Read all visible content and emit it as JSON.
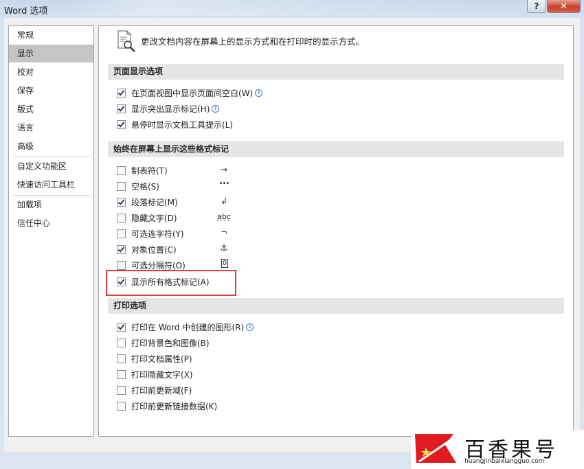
{
  "window": {
    "title": "Word 选项",
    "help_label": "?",
    "close_label": "✕"
  },
  "sidebar": {
    "items": [
      {
        "label": "常规"
      },
      {
        "label": "显示"
      },
      {
        "label": "校对"
      },
      {
        "label": "保存"
      },
      {
        "label": "版式"
      },
      {
        "label": "语言"
      },
      {
        "label": "高级"
      },
      {
        "label": "自定义功能区"
      },
      {
        "label": "快速访问工具栏"
      },
      {
        "label": "加载项"
      },
      {
        "label": "信任中心"
      }
    ],
    "selected": "显示"
  },
  "content": {
    "intro": "更改文档内容在屏幕上的显示方式和在打印时的显示方式。",
    "page_display": {
      "heading": "页面显示选项",
      "options": [
        {
          "label": "在页面视图中显示页面间空白(W)",
          "checked": true,
          "info": true
        },
        {
          "label": "显示突出显示标记(H)",
          "checked": true,
          "info": true
        },
        {
          "label": "悬停时显示文档工具提示(L)",
          "checked": true,
          "info": false
        }
      ]
    },
    "format_marks": {
      "heading": "始终在屏幕上显示这些格式标记",
      "options": [
        {
          "label": "制表符(T)",
          "checked": false,
          "symbol": "→"
        },
        {
          "label": "空格(S)",
          "checked": false,
          "symbol": "•••"
        },
        {
          "label": "段落标记(M)",
          "checked": true,
          "symbol": "↲"
        },
        {
          "label": "隐藏文字(D)",
          "checked": false,
          "symbol": "abc"
        },
        {
          "label": "可选连字符(Y)",
          "checked": false,
          "symbol": "¬"
        },
        {
          "label": "对象位置(C)",
          "checked": true,
          "symbol": "⚓"
        },
        {
          "label": "可选分隔符(O)",
          "checked": false,
          "symbol": "0"
        },
        {
          "label": "显示所有格式标记(A)",
          "checked": true,
          "symbol": ""
        }
      ]
    },
    "print": {
      "heading": "打印选项",
      "options": [
        {
          "label": "打印在 Word 中创建的图形(R)",
          "checked": true,
          "info": true
        },
        {
          "label": "打印背景色和图像(B)",
          "checked": false,
          "info": false
        },
        {
          "label": "打印文档属性(P)",
          "checked": false,
          "info": false
        },
        {
          "label": "打印隐藏文字(X)",
          "checked": false,
          "info": false
        },
        {
          "label": "打印前更新域(F)",
          "checked": false,
          "info": false
        },
        {
          "label": "打印前更新链接数据(K)",
          "checked": false,
          "info": false
        }
      ]
    }
  },
  "watermark": {
    "brand": "百香果号",
    "url": "huangjinbaixiangguo.com"
  }
}
